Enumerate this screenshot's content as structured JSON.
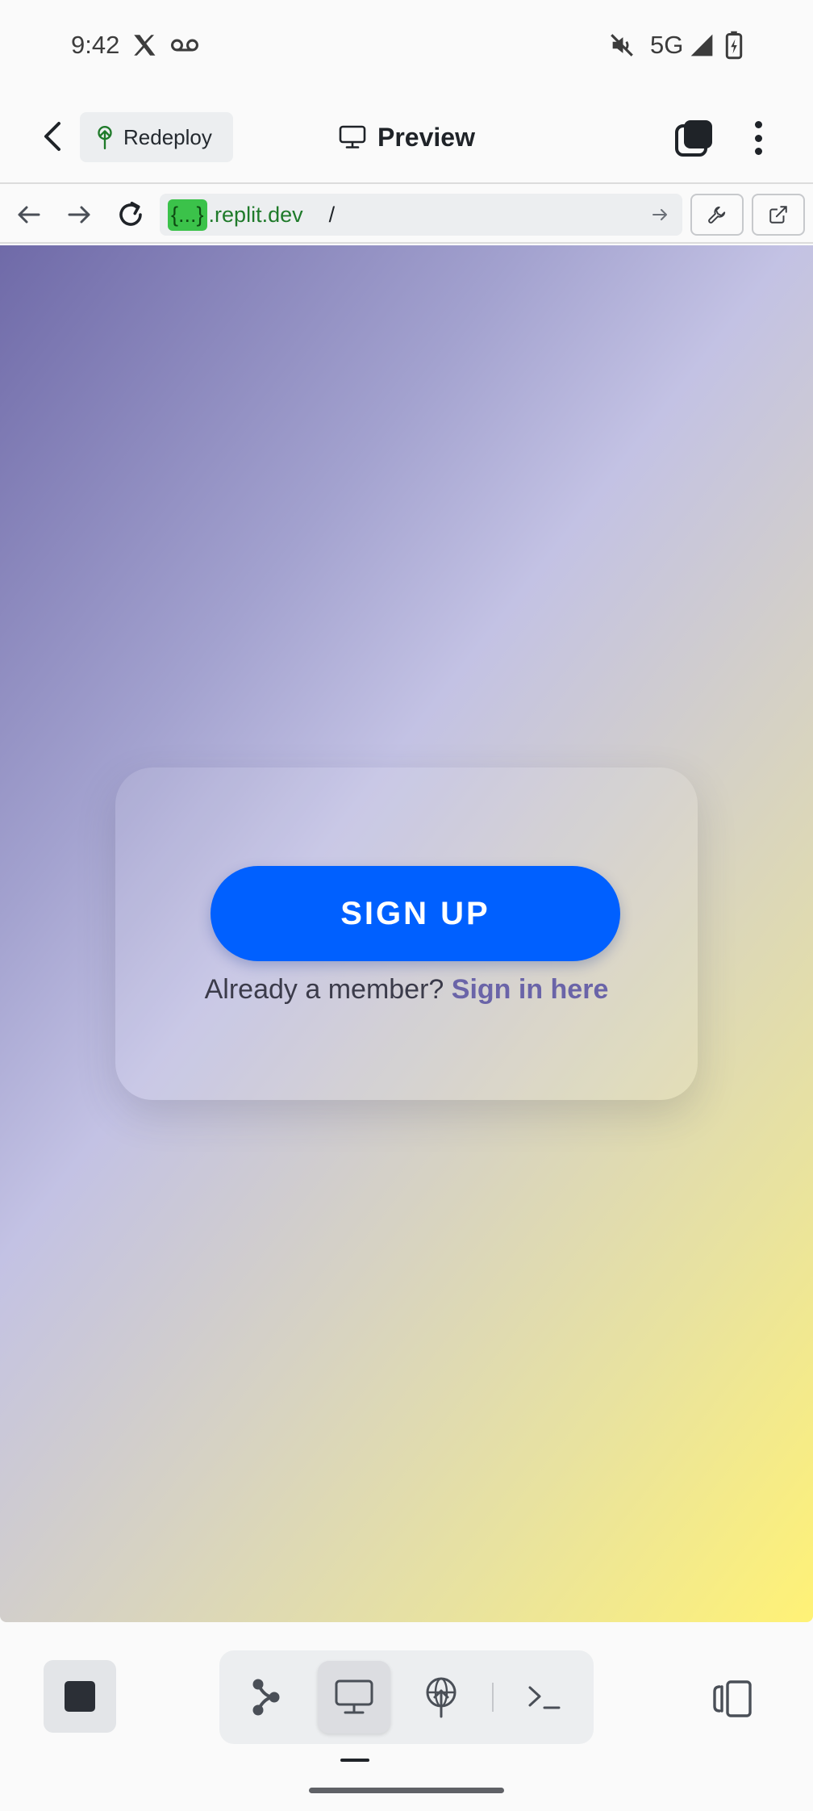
{
  "status_bar": {
    "time": "9:42",
    "network": "5G",
    "icons": [
      "x-logo-icon",
      "voicemail-icon",
      "mute-icon",
      "signal-icon",
      "battery-icon"
    ]
  },
  "header": {
    "redeploy_label": "Redeploy",
    "title": "Preview"
  },
  "url_bar": {
    "host_badge": "{...}",
    "host": ".replit.dev",
    "path": "/"
  },
  "preview": {
    "signup_label": "SIGN UP",
    "member_prompt": "Already a member?",
    "signin_link": "Sign in here"
  },
  "colors": {
    "signup_button": "#0060ff",
    "signin_link": "#6a64a8",
    "url_badge": "#3bc24a",
    "gradient_start": "#6f6aa8",
    "gradient_end": "#fff276"
  },
  "bottom_bar": {
    "tools": [
      "stop-icon",
      "git-icon",
      "monitor-icon",
      "deploy-icon",
      "terminal-icon",
      "split-view-icon"
    ],
    "active_tool": "monitor-icon"
  }
}
